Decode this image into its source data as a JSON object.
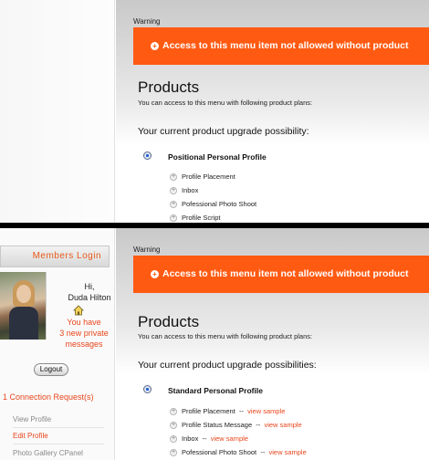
{
  "top": {
    "warning_label": "Warning",
    "alert_text": "Access to this menu item not allowed without product",
    "products_title": "Products",
    "products_subtitle": "You can access to this menu with following product plans:",
    "upgrade_title": "Your current product upgrade possibility:",
    "plan_name": "Positional Personal Profile",
    "features": [
      "Profile Placement",
      "Inbox",
      "Pofessional Photo Shoot",
      "Profile Script"
    ]
  },
  "bottom": {
    "sidebar": {
      "members_title": "Members Login",
      "greeting": "Hi,",
      "user_name": "Duda Hilton",
      "msg_line1": "You have",
      "msg_line2": "3 new private",
      "msg_line3": "messages",
      "logout_label": "Logout",
      "connection_requests": "1 Connection Request(s)",
      "nav": [
        "View Profile",
        "Edit Profile",
        "Photo Gallery CPanel"
      ]
    },
    "warning_label": "Warning",
    "alert_text": "Access to this menu item not allowed without product",
    "products_title": "Products",
    "products_subtitle": "You can access to this menu with following product plans:",
    "upgrade_title": "Your current product upgrade possibilities:",
    "plan_name": "Standard Personal Profile",
    "separator": "--",
    "view_sample": "view sample",
    "features": [
      "Profile Placement",
      "Profile Status Message",
      "Inbox",
      "Pofessional Photo Shoot"
    ]
  },
  "colors": {
    "accent": "#ff5a12",
    "link": "#e8461c",
    "radio": "#1f5fd6"
  },
  "icons": {
    "alert": "plus-circle-icon",
    "feature": "plus-circle-icon",
    "home": "house-icon"
  }
}
